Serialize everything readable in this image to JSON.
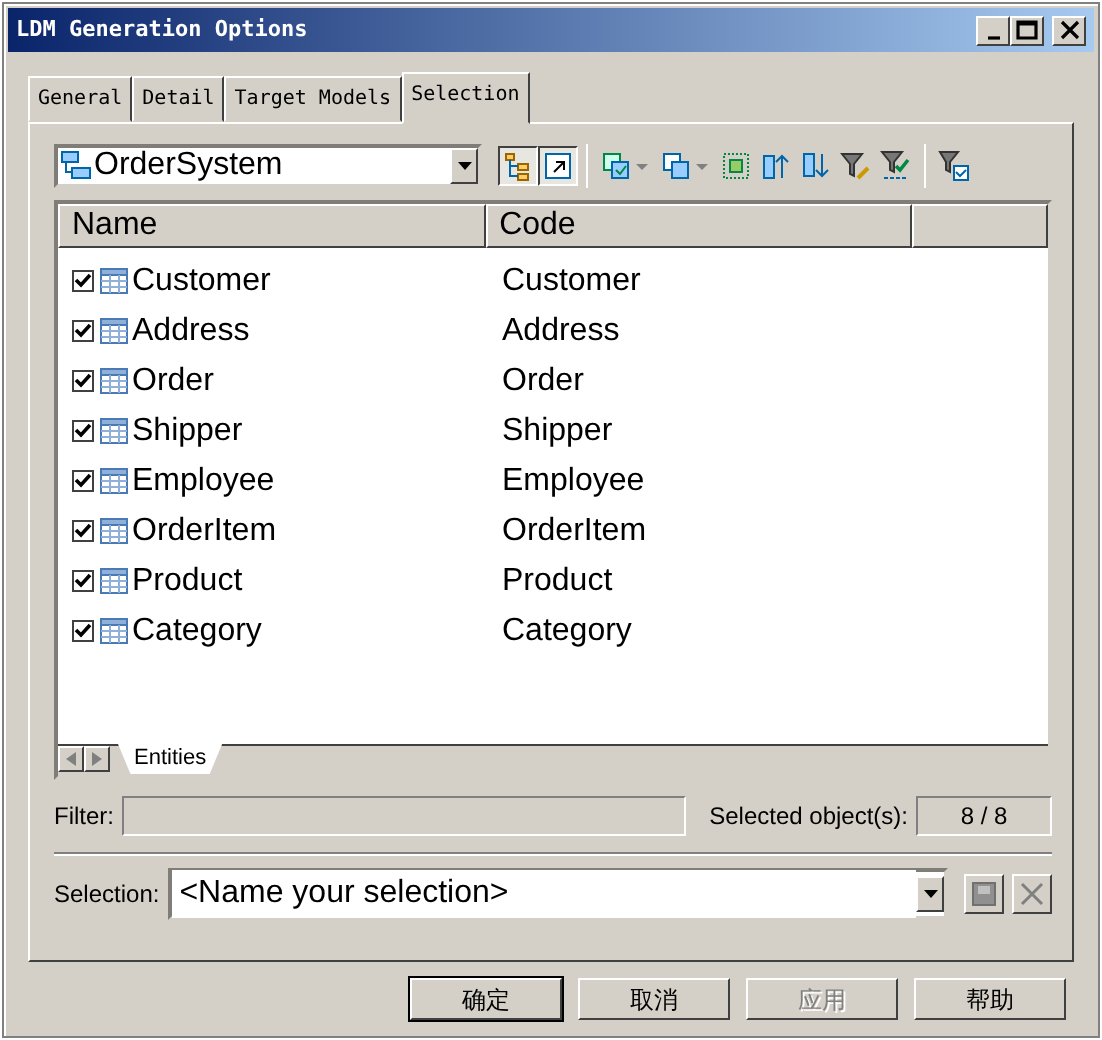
{
  "window": {
    "title": "LDM Generation Options"
  },
  "tabs": [
    {
      "label": "General",
      "selected": false
    },
    {
      "label": "Detail",
      "selected": false
    },
    {
      "label": "Target Models",
      "selected": false
    },
    {
      "label": "Selection",
      "selected": true
    }
  ],
  "model_combo": {
    "value": "OrderSystem"
  },
  "table": {
    "columns": [
      "Name",
      "Code"
    ],
    "rows": [
      {
        "name": "Customer",
        "code": "Customer",
        "checked": true
      },
      {
        "name": "Address",
        "code": "Address",
        "checked": true
      },
      {
        "name": "Order",
        "code": "Order",
        "checked": true
      },
      {
        "name": "Shipper",
        "code": "Shipper",
        "checked": true
      },
      {
        "name": "Employee",
        "code": "Employee",
        "checked": true
      },
      {
        "name": "OrderItem",
        "code": "OrderItem",
        "checked": true
      },
      {
        "name": "Product",
        "code": "Product",
        "checked": true
      },
      {
        "name": "Category",
        "code": "Category",
        "checked": true
      }
    ]
  },
  "sheet_tabs": [
    {
      "label": "Entities",
      "selected": true
    }
  ],
  "filter": {
    "label": "Filter:"
  },
  "selected_count": {
    "label": "Selected object(s):",
    "value": "8 / 8"
  },
  "selection": {
    "label": "Selection:",
    "placeholder": "<Name your selection>"
  },
  "buttons": [
    {
      "label": "确定",
      "disabled": false,
      "default": true
    },
    {
      "label": "取消",
      "disabled": false,
      "default": false
    },
    {
      "label": "应用",
      "disabled": true,
      "default": false
    },
    {
      "label": "帮助",
      "disabled": false,
      "default": false
    }
  ]
}
